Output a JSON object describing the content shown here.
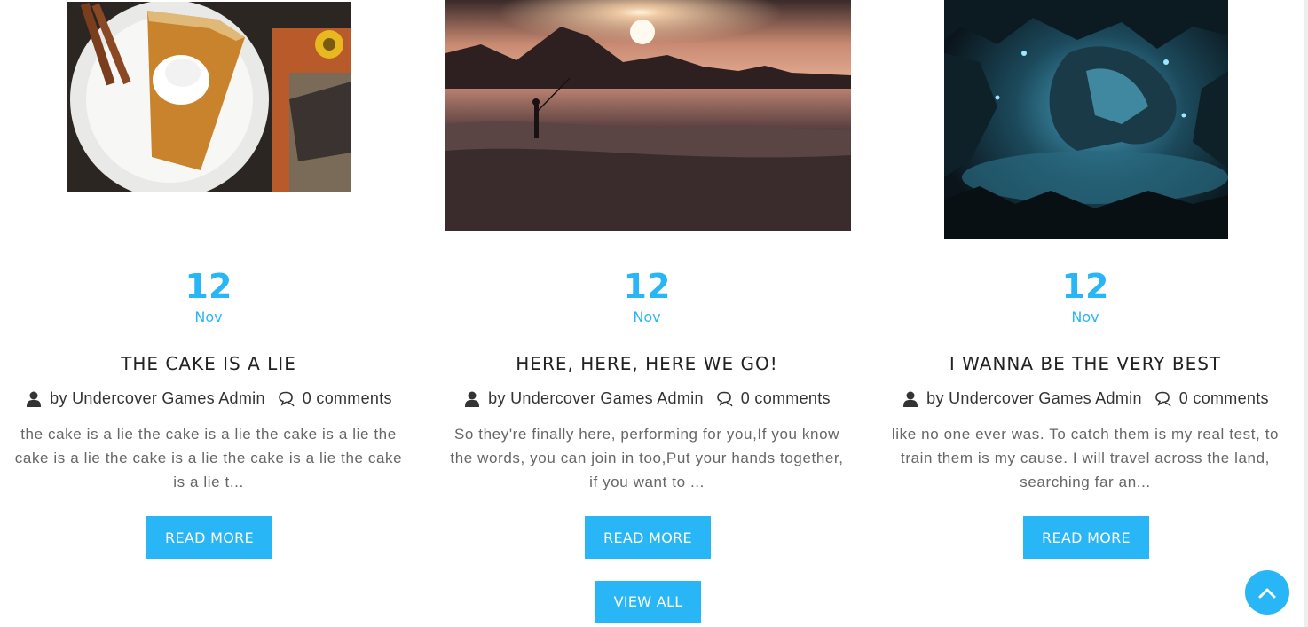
{
  "theme": {
    "accent": "#29b6f6",
    "title_color": "#222222",
    "text_color": "#666666",
    "meta_color": "#333333"
  },
  "posts": [
    {
      "image_subject": "Slice of pumpkin pie with whipped cream and cinnamon sticks on a white plate",
      "day": "12",
      "month": "Nov",
      "title": "THE CAKE IS A LIE",
      "author": "by Undercover Games Admin",
      "comments": "0 comments",
      "excerpt": "the cake is a lie the cake is a lie the cake is a lie the cake is a lie the cake is a lie the cake is a lie the cake is a lie t...",
      "button": "READ MORE"
    },
    {
      "image_subject": "Silhouette of a person fishing on a beach at sunset with mountains",
      "day": "12",
      "month": "Nov",
      "title": "HERE, HERE, HERE WE GO!",
      "author": "by Undercover Games Admin",
      "comments": "0 comments",
      "excerpt": "So they're finally here, performing for you,If you know the words, you can join in too,Put your hands together, if you want to ...",
      "button": "READ MORE"
    },
    {
      "image_subject": "Glowing blue crystal cave with an underground lake",
      "day": "12",
      "month": "Nov",
      "title": "I WANNA BE THE VERY BEST",
      "author": "by Undercover Games Admin",
      "comments": "0 comments",
      "excerpt": "like no one ever was. To catch them is my real test, to train them is my cause. I will travel across the land, searching far an...",
      "button": "READ MORE"
    }
  ],
  "view_all": "VIEW ALL",
  "icons": {
    "author": "user-icon",
    "comments": "comments-icon",
    "back_to_top": "chevron-up-icon"
  }
}
